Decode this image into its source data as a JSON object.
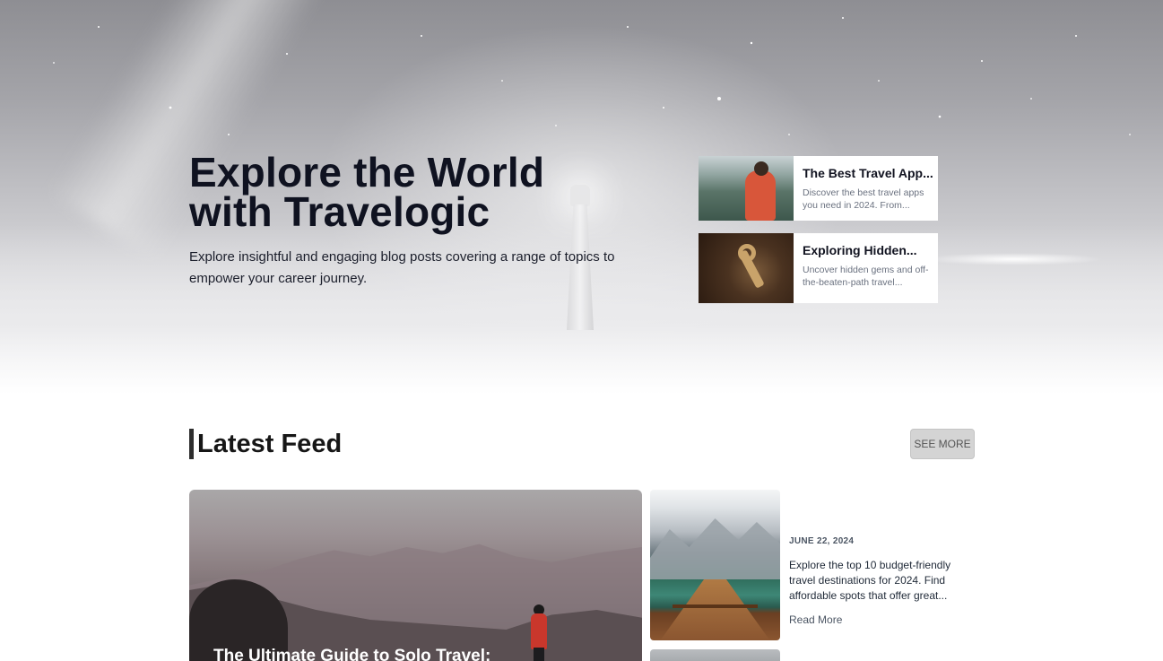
{
  "hero": {
    "title_line1": "Explore the World",
    "title_line2": "with Travelogic",
    "subtitle": "Explore insightful and engaging blog posts covering a range of topics to empower your career journey.",
    "cards": [
      {
        "title": "The Best Travel App...",
        "description": "Discover the best travel apps you need in 2024. From..."
      },
      {
        "title": "Exploring Hidden...",
        "description": "Uncover hidden gems and off-the-beaten-path travel..."
      }
    ]
  },
  "feed": {
    "heading": "Latest Feed",
    "see_more_label": "SEE MORE",
    "featured_title": "The Ultimate Guide to Solo Travel:",
    "post": {
      "date": "JUNE 22, 2024",
      "excerpt": "Explore the top 10 budget-friendly travel destinations for 2024. Find affordable spots that offer great...",
      "read_more_label": "Read More"
    }
  }
}
